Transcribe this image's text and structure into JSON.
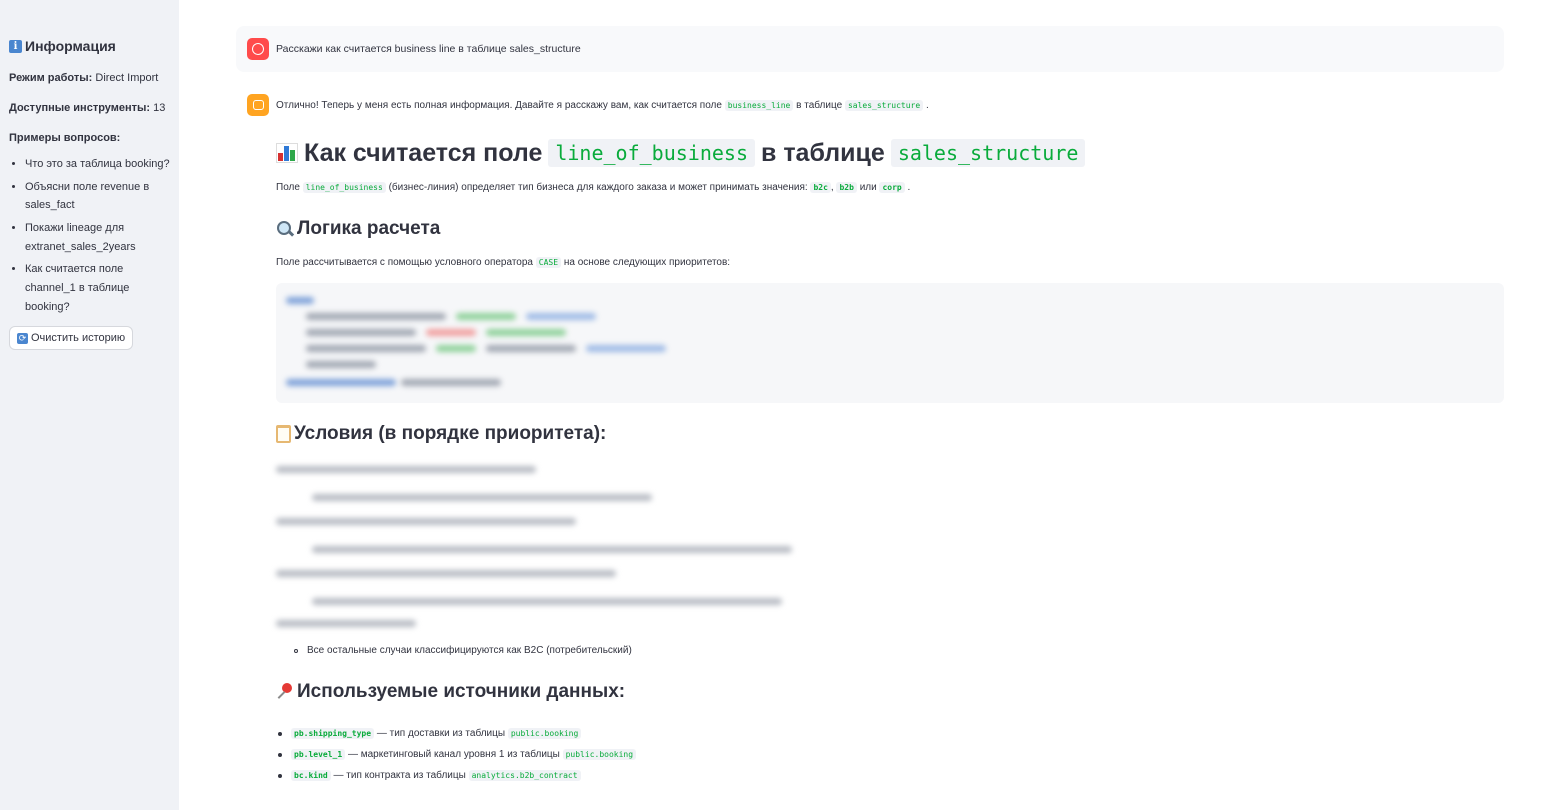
{
  "sidebar": {
    "title": "Информация",
    "mode_label": "Режим работы:",
    "mode_value": "Direct Import",
    "tools_label": "Доступные инструменты:",
    "tools_value": "13",
    "examples_label": "Примеры вопросов:",
    "examples": [
      "Что это за таблица booking?",
      "Объясни поле revenue в sales_fact",
      "Покажи lineage для extranet_sales_2years",
      "Как считается поле channel_1 в таблице booking?"
    ],
    "clear_button": "Очистить историю"
  },
  "user_message": "Расскажи как считается business line в таблице sales_structure",
  "assistant": {
    "intro_a": "Отлично! Теперь у меня есть полная информация. Давайте я расскажу вам, как считается поле",
    "intro_code1": "business_line",
    "intro_b": "в таблице",
    "intro_code2": "sales_structure",
    "intro_c": ".",
    "h1_a": "Как считается поле",
    "h1_code1": "line_of_business",
    "h1_b": "в таблице",
    "h1_code2": "sales_structure",
    "p1_a": "Поле",
    "p1_code": "line_of_business",
    "p1_b": "(бизнес-линия) определяет тип бизнеса для каждого заказа и может принимать значения:",
    "p1_v1": "b2c",
    "p1_sep1": ",",
    "p1_v2": "b2b",
    "p1_or": "или",
    "p1_v3": "corp",
    "p1_end": ".",
    "h2_logic": "Логика расчета",
    "p2_a": "Поле рассчитывается с помощью условного оператора",
    "p2_code": "CASE",
    "p2_b": "на основе следующих приоритетов:",
    "h2_conditions": "Условия (в порядке приоритета):",
    "remaining_case": "Все остальные случаи классифицируются как B2C (потребительский)",
    "h2_sources": "Используемые источники данных:",
    "sources": [
      {
        "code": "pb.shipping_type",
        "text": "— тип доставки из таблицы",
        "table": "public.booking"
      },
      {
        "code": "pb.level_1",
        "text": "— маркетинговый канал уровня 1 из таблицы",
        "table": "public.booking"
      },
      {
        "code": "bc.kind",
        "text": "— тип контракта из таблицы",
        "table": "analytics.b2b_contract"
      }
    ]
  }
}
